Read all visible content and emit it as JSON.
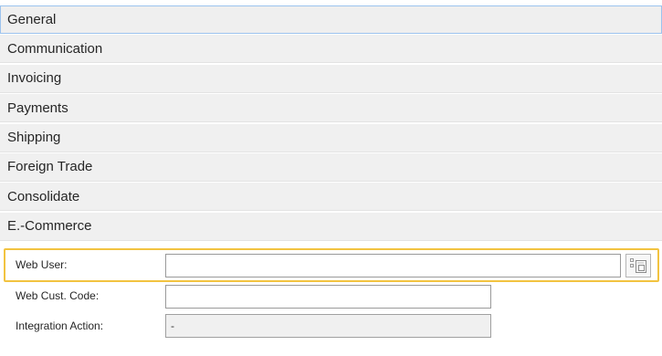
{
  "sections": [
    {
      "label": "General",
      "active": true
    },
    {
      "label": "Communication",
      "active": false
    },
    {
      "label": "Invoicing",
      "active": false
    },
    {
      "label": "Payments",
      "active": false
    },
    {
      "label": "Shipping",
      "active": false
    },
    {
      "label": "Foreign Trade",
      "active": false
    },
    {
      "label": "Consolidate",
      "active": false
    },
    {
      "label": "E.-Commerce",
      "active": false
    }
  ],
  "fields": {
    "web_user": {
      "label": "Web User:",
      "value": ""
    },
    "web_cust_code": {
      "label": "Web Cust. Code:",
      "value": ""
    },
    "integration_action": {
      "label": "Integration Action:",
      "value": "-"
    }
  },
  "icons": {
    "lookup": "lookup-icon"
  },
  "colors": {
    "focus_highlight": "#f2c340",
    "active_section_border": "#9cc3ee"
  }
}
